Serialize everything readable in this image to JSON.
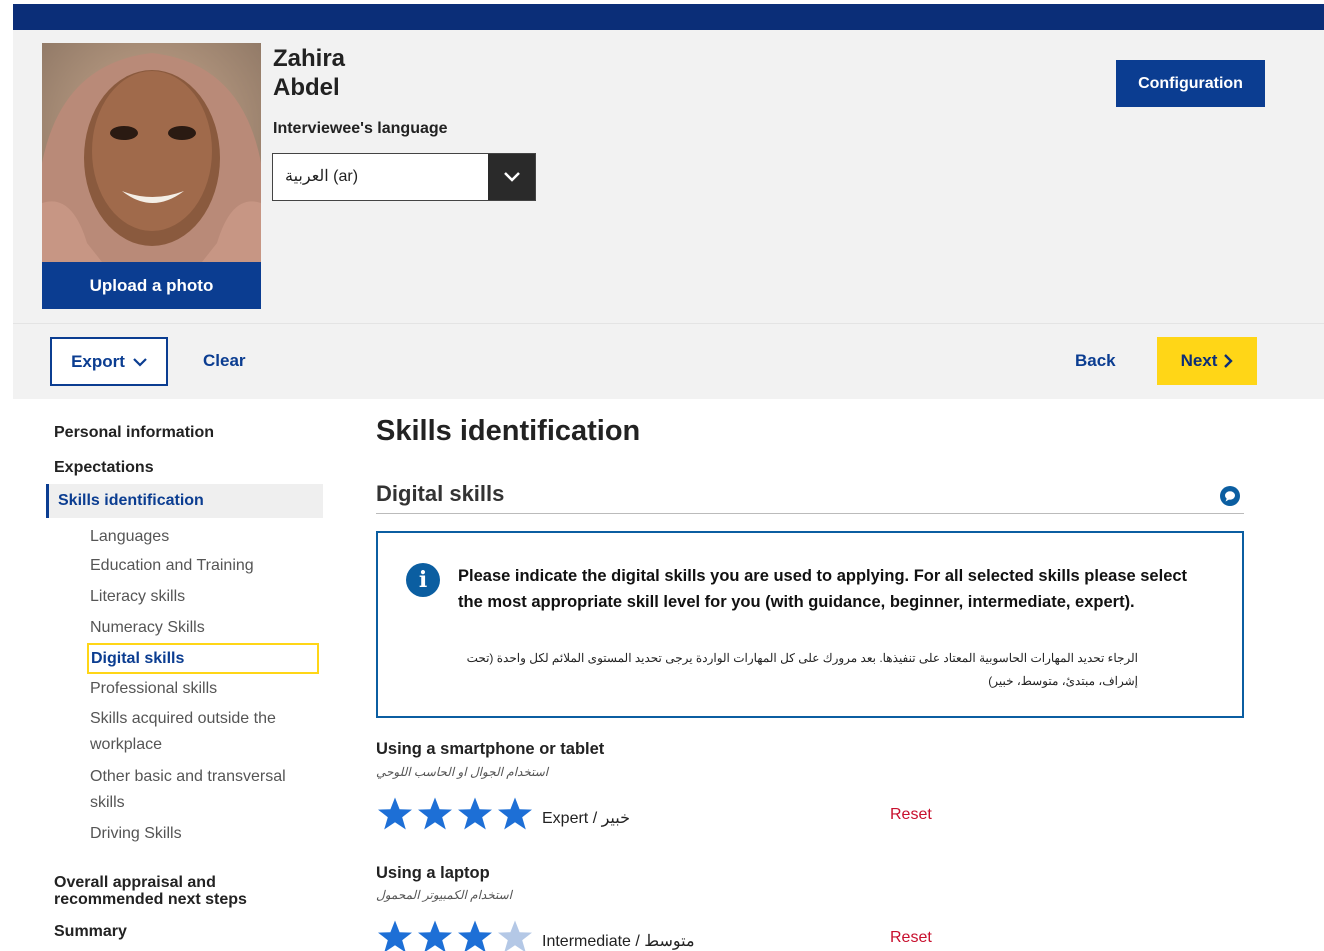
{
  "colors": {
    "brand": "#0b3d91",
    "accent": "#ffd617",
    "star_filled": "#1d6fd6",
    "star_empty": "#b4c8e6",
    "reset": "#c8102e"
  },
  "profile": {
    "first_name": "Zahira",
    "last_name": "Abdel",
    "upload_label": "Upload a photo",
    "language_label": "Interviewee's language",
    "language_value": "العربية (ar)",
    "config_label": "Configuration"
  },
  "toolbar": {
    "export_label": "Export",
    "clear_label": "Clear",
    "back_label": "Back",
    "next_label": "Next"
  },
  "sidebar": {
    "personal": "Personal information",
    "expectations": "Expectations",
    "skills": "Skills identification",
    "sub": {
      "languages": "Languages",
      "education": "Education and Training",
      "literacy": "Literacy skills",
      "numeracy": "Numeracy Skills",
      "digital": "Digital skills",
      "professional": "Professional skills",
      "outside_1": "Skills acquired outside the",
      "outside_2": "workplace",
      "other_1": "Other basic and transversal",
      "other_2": "skills",
      "driving": "Driving Skills"
    },
    "overall_1": "Overall appraisal and",
    "overall_2": "recommended next steps",
    "summary": "Summary"
  },
  "main": {
    "title": "Skills identification",
    "section_title": "Digital skills",
    "info_en": "Please indicate the digital skills you are used to applying. For all selected skills please select the most appropriate skill level for you (with guidance, beginner, intermediate, expert).",
    "info_ar": "الرجاء تحديد المهارات الحاسوبية المعتاد على تنفيذها. بعد مرورك على كل المهارات الواردة يرجى تحديد المستوى الملائم لكل واحدة (تحت إشراف، مبتدئ، متوسط، خبير)",
    "skills": [
      {
        "title": "Using a smartphone or tablet",
        "title_ar": "استخدام الجوال او الحاسب اللوحي",
        "rating": 4,
        "max": 4,
        "level": "Expert / خبير",
        "reset": "Reset"
      },
      {
        "title": "Using a laptop",
        "title_ar": "استخدام الكمبيوتر المحمول",
        "rating": 3,
        "max": 4,
        "level": "Intermediate / متوسط",
        "reset": "Reset"
      }
    ]
  }
}
